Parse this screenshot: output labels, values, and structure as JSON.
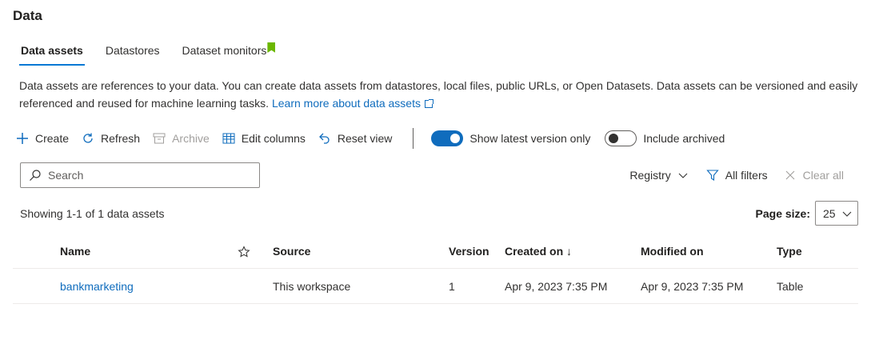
{
  "page": {
    "title": "Data"
  },
  "tabs": [
    {
      "label": "Data assets",
      "active": true
    },
    {
      "label": "Datastores",
      "active": false
    },
    {
      "label": "Dataset monitors",
      "active": false
    }
  ],
  "description": {
    "text": "Data assets are references to your data. You can create data assets from datastores, local files, public URLs, or Open Datasets. Data assets can be versioned and easily referenced and reused for machine learning tasks.",
    "link": "Learn more about data assets"
  },
  "toolbar": {
    "create": "Create",
    "refresh": "Refresh",
    "archive": "Archive",
    "edit_columns": "Edit columns",
    "reset_view": "Reset view",
    "show_latest": "Show latest version only",
    "show_latest_on": true,
    "include_archived": "Include archived",
    "include_archived_on": false
  },
  "search": {
    "placeholder": "Search"
  },
  "filters": {
    "registry": "Registry",
    "all_filters": "All filters",
    "clear_all": "Clear all"
  },
  "results": {
    "showing": "Showing 1-1 of 1 data assets"
  },
  "pagination": {
    "label": "Page size:",
    "value": "25"
  },
  "table": {
    "columns": {
      "name": "Name",
      "source": "Source",
      "version": "Version",
      "created": "Created on ↓",
      "modified": "Modified on",
      "type": "Type"
    },
    "rows": [
      {
        "name": "bankmarketing",
        "source": "This workspace",
        "version": "1",
        "created": "Apr 9, 2023 7:35 PM",
        "modified": "Apr 9, 2023 7:35 PM",
        "type": "Table"
      }
    ]
  },
  "colors": {
    "accent": "#0f6cbd",
    "tab_underline": "#0078d4",
    "flag": "#6bb700",
    "disabled": "#a19f9d"
  }
}
